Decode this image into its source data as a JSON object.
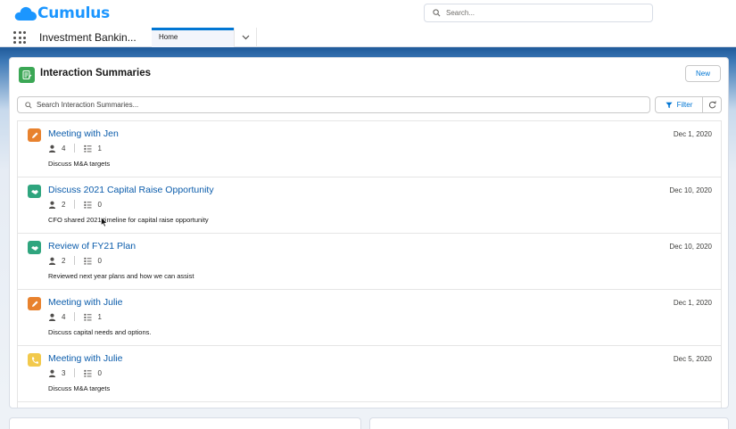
{
  "app": {
    "brand": "Cumulus",
    "search_placeholder": "Search...",
    "app_name": "Investment Bankin...",
    "tabs": [
      {
        "label": "Home",
        "active": true
      }
    ],
    "accent": "#0176d3"
  },
  "card": {
    "title": "Interaction Summaries",
    "new_label": "New",
    "search_placeholder": "Search Interaction Summaries...",
    "filter_label": "Filter"
  },
  "rows": [
    {
      "icon": "pencil-icon",
      "icon_color": "#e8822e",
      "title": "Meeting with Jen",
      "date": "Dec 1, 2020",
      "attendees": "4",
      "tasks": "1",
      "description": "Discuss M&A targets"
    },
    {
      "icon": "handshake-icon",
      "icon_color": "#2fa57e",
      "title": "Discuss 2021 Capital Raise Opportunity",
      "date": "Dec 10, 2020",
      "attendees": "2",
      "tasks": "0",
      "description": "CFO shared 2021 timeline for capital raise opportunity"
    },
    {
      "icon": "handshake-icon",
      "icon_color": "#2fa57e",
      "title": "Review of FY21 Plan",
      "date": "Dec 10, 2020",
      "attendees": "2",
      "tasks": "0",
      "description": "Reviewed next year plans and how we can assist"
    },
    {
      "icon": "pencil-icon",
      "icon_color": "#e8822e",
      "title": "Meeting with Julie",
      "date": "Dec 1, 2020",
      "attendees": "4",
      "tasks": "1",
      "description": "Discuss capital needs and options."
    },
    {
      "icon": "phone-icon",
      "icon_color": "#f2c94c",
      "title": "Meeting with Julie",
      "date": "Dec 5, 2020",
      "attendees": "3",
      "tasks": "0",
      "description": "Discuss M&A targets"
    }
  ]
}
